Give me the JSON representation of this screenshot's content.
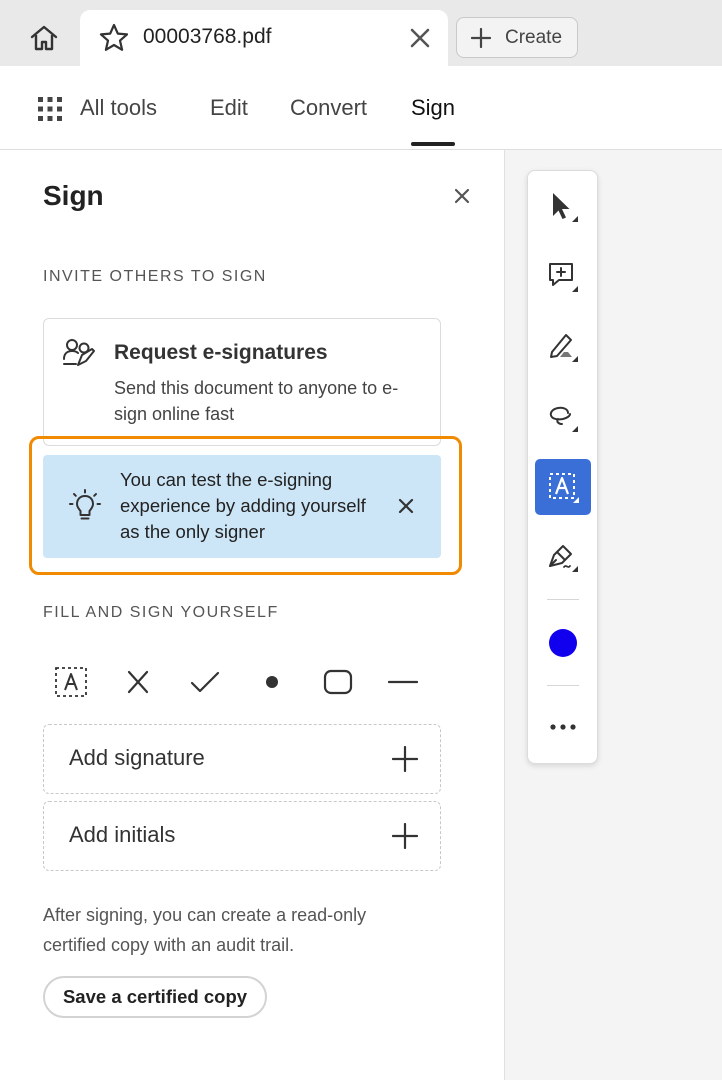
{
  "tabbar": {
    "home_icon": "home-icon",
    "doc_tab": {
      "title": "00003768.pdf",
      "star_icon": "star-icon",
      "close_icon": "close-icon"
    },
    "create_button": {
      "label": "Create",
      "icon": "plus-icon"
    }
  },
  "nav": {
    "items": [
      {
        "label": "All tools",
        "icon": "grid-icon"
      },
      {
        "label": "Edit"
      },
      {
        "label": "Convert"
      },
      {
        "label": "Sign",
        "active": true
      }
    ]
  },
  "panel": {
    "title": "Sign",
    "invite_section": "INVITE OTHERS TO SIGN",
    "request": {
      "title": "Request e-signatures",
      "description": "Send this document to anyone to e-sign online fast",
      "icon": "people-sign-icon"
    },
    "tip": {
      "text": "You can test the e-signing experience by adding yourself as the only signer",
      "icon": "lightbulb-icon",
      "highlight_color": "#f08a00",
      "background_color": "#cde6f7"
    },
    "fill_section": "FILL AND SIGN YOURSELF",
    "fill_tools": [
      "text-field-icon",
      "cross-mark-icon",
      "checkmark-icon",
      "dot-icon",
      "rounded-rectangle-icon",
      "line-icon"
    ],
    "add_signature": "Add signature",
    "add_initials": "Add initials",
    "cert_note": "After signing, you can create a read-only certified copy with an audit trail.",
    "cert_button": "Save a certified copy"
  },
  "quick_toolbar": {
    "tools": [
      "select-pointer-icon",
      "add-comment-icon",
      "highlight-icon",
      "draw-freeform-icon",
      "text-selection-icon",
      "pen-sign-icon"
    ],
    "active_tool": "text-selection-icon",
    "active_color": "#3a6fd8",
    "current_color": "#1100ee",
    "more_icon": "more-icon"
  }
}
